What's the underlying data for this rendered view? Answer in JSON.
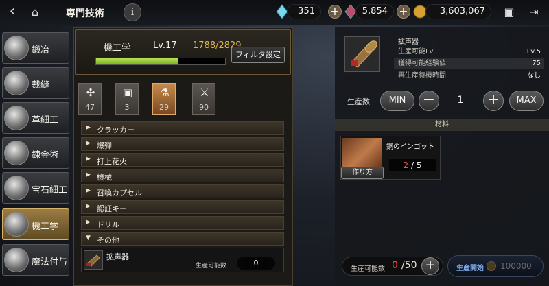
{
  "header": {
    "back_icon": "back-arrow-icon",
    "home_icon": "home-icon",
    "title": "専門技術",
    "info_label": "i",
    "gem_blue": "351",
    "gem_red": "5,854",
    "gold": "3,603,067"
  },
  "sidebar": {
    "items": [
      {
        "label": "鍛冶"
      },
      {
        "label": "裁縫"
      },
      {
        "label": "革細工"
      },
      {
        "label": "錬金術"
      },
      {
        "label": "宝石細工"
      },
      {
        "label": "機工学"
      },
      {
        "label": "魔法付与"
      }
    ],
    "active_index": 5
  },
  "skill": {
    "name": "機工学",
    "level": "Lv.17",
    "exp": "1788/2829",
    "exp_current": 1788,
    "exp_max": 2829,
    "filter_label": "フィルタ設定"
  },
  "category_tabs": [
    {
      "icon": "wrench-icon",
      "count": "47"
    },
    {
      "icon": "chip-icon",
      "count": "3"
    },
    {
      "icon": "flask-icon",
      "count": "29"
    },
    {
      "icon": "sword-icon",
      "count": "90"
    }
  ],
  "list": {
    "rows": [
      {
        "arrow": "▶",
        "label": "クラッカー"
      },
      {
        "arrow": "▶",
        "label": "爆弾"
      },
      {
        "arrow": "▶",
        "label": "打上花火"
      },
      {
        "arrow": "▶",
        "label": "機械"
      },
      {
        "arrow": "▶",
        "label": "召喚カプセル"
      },
      {
        "arrow": "▶",
        "label": "認証キー"
      },
      {
        "arrow": "▶",
        "label": "ドリル"
      },
      {
        "arrow": "▼",
        "label": "その他"
      }
    ],
    "item": {
      "name": "拡声器",
      "prod_label": "生産可能数",
      "prod_value": "0"
    }
  },
  "detail": {
    "name": "拡声器",
    "rows": [
      {
        "key": "生産可能Lv",
        "value": "Lv.5"
      },
      {
        "key": "獲得可能経験値",
        "value": "75"
      },
      {
        "key": "再生産待機時間",
        "value": "なし"
      }
    ],
    "prod_label": "生産数",
    "min_label": "MIN",
    "minus_label": "−",
    "quantity": "1",
    "plus_label": "+",
    "max_label": "MAX",
    "materials_header": "材料",
    "material": {
      "name": "銅のインゴット",
      "have": "2",
      "sep": "/",
      "need": "5",
      "make_label": "作り方"
    },
    "bottom": {
      "count_label": "生産可能数",
      "count_value": "0",
      "count_max": "/50",
      "plus_label": "+",
      "start_label": "生産開始",
      "cost": "100000"
    }
  }
}
